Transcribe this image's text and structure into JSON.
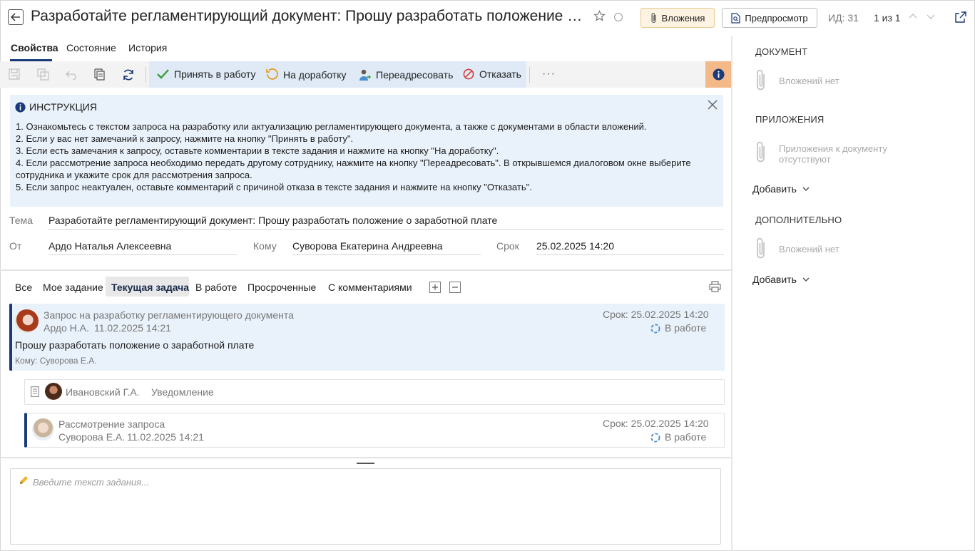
{
  "header": {
    "title": "Разработайте регламентирующий документ: Прошу разработать положение о зар...",
    "attachments_label": "Вложения",
    "preview_label": "Предпросмотр",
    "id_label": "ИД: 31",
    "pager": "1 из 1"
  },
  "tabs": [
    {
      "label": "Свойства",
      "active": true
    },
    {
      "label": "Состояние",
      "active": false
    },
    {
      "label": "История",
      "active": false
    }
  ],
  "toolbar": {
    "accept_label": "Принять в работу",
    "rework_label": "На доработку",
    "redirect_label": "Переадресовать",
    "reject_label": "Отказать",
    "more": "···"
  },
  "instruction": {
    "title": "ИНСТРУКЦИЯ",
    "lines": [
      "1. Ознакомьтесь с текстом запроса на разработку или актуализацию регламентирующего документа, а также с документами в области вложений.",
      "2. Если у вас нет замечаний к запросу, нажмите на кнопку \"Принять в работу\".",
      "3. Если есть замечания к запросу, оставьте комментарии в тексте задания и нажмите на кнопку \"На доработку\".",
      "4. Если рассмотрение запроса необходимо передать другому сотруднику, нажмите на кнопку \"Переадресовать\". В открывшемся диалоговом окне выберите сотрудника и укажите срок для рассмотрения запроса.",
      "5. Если запрос неактуален, оставьте комментарий с причиной отказа в тексте задания и нажмите на кнопку \"Отказать\"."
    ]
  },
  "fields": {
    "subject_label": "Тема",
    "subject_value": "Разработайте регламентирующий документ: Прошу разработать положение о заработной плате",
    "from_label": "От",
    "from_value": "Ардо Наталья Алексеевна",
    "to_label": "Кому",
    "to_value": "Суворова Екатерина Андреевна",
    "deadline_label": "Срок",
    "deadline_value": "25.02.2025 14:20"
  },
  "filters": [
    {
      "label": "Все",
      "active": false
    },
    {
      "label": "Мое задание",
      "active": false
    },
    {
      "label": "Текущая задача",
      "active": true
    },
    {
      "label": "В работе",
      "active": false
    },
    {
      "label": "Просроченные",
      "active": false
    },
    {
      "label": "С комментариями",
      "active": false
    }
  ],
  "tasks": {
    "main": {
      "title": "Запрос на разработку регламентирующего документа",
      "author": "Ардо Н.А.",
      "date": "11.02.2025 14:21",
      "deadline": "Срок: 25.02.2025 14:20",
      "status": "В работе",
      "text": "Прошу разработать положение о заработной плате",
      "to": "Кому: Суворова Е.А."
    },
    "notice": {
      "author": "Ивановский Г.А.",
      "type": "Уведомление"
    },
    "review": {
      "title": "Рассмотрение запроса",
      "author": "Суворова Е.А.",
      "date": "11.02.2025 14:21",
      "deadline": "Срок: 25.02.2025 14:20",
      "status": "В работе"
    }
  },
  "editor": {
    "placeholder": "Введите текст задания..."
  },
  "right_panel": {
    "document_title": "ДОКУМЕНТ",
    "document_empty": "Вложений нет",
    "attachments_title": "ПРИЛОЖЕНИЯ",
    "attachments_empty": "Приложения к документу отсутствуют",
    "add_label": "Добавить",
    "extra_title": "ДОПОЛНИТЕЛЬНО",
    "extra_empty": "Вложений нет",
    "extra_add_label": "Добавить"
  },
  "colors": {
    "accent": "#1a3a7a",
    "instruction_bg": "#e9f1fa",
    "action_group_bg": "#dfeaf6",
    "info_button": "#f4b988",
    "attach_button_bg": "#fdf3e2"
  }
}
